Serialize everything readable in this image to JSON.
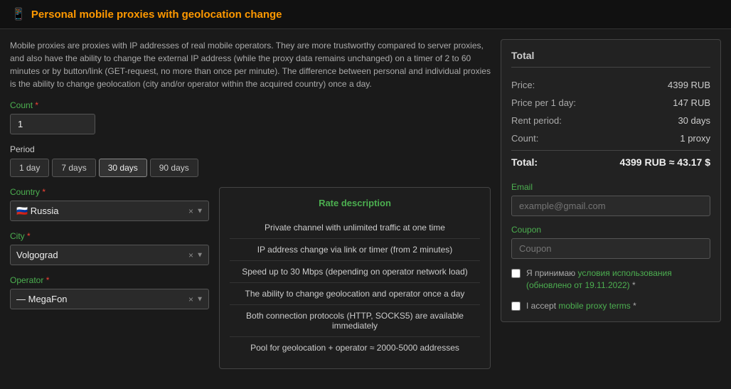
{
  "header": {
    "icon": "📱",
    "title": "Personal mobile proxies with geolocation change"
  },
  "description": "Mobile proxies are proxies with IP addresses of real mobile operators. They are more trustworthy compared to server proxies, and also have the ability to change the external IP address (while the proxy data remains unchanged) on a timer of 2 to 60 minutes or by button/link (GET-request, no more than once per minute). The difference between personal and individual proxies is the ability to change geolocation (city and/or operator within the acquired country) once a day.",
  "count": {
    "label": "Count",
    "required": "*",
    "value": "1"
  },
  "period": {
    "label": "Period",
    "options": [
      "1 day",
      "7 days",
      "30 days",
      "90 days"
    ],
    "active_index": 2
  },
  "country": {
    "label": "Country",
    "required": "*",
    "value": "Russia",
    "flag": "🇷🇺"
  },
  "city": {
    "label": "City",
    "required": "*",
    "value": "Volgograd"
  },
  "operator": {
    "label": "Operator",
    "required": "*",
    "value": "MegaFon"
  },
  "rate": {
    "title": "Rate description",
    "items": [
      "Private channel with unlimited traffic at one time",
      "IP address change via link or timer (from 2 minutes)",
      "Speed up to 30 Mbps (depending on operator network load)",
      "The ability to change geolocation and operator once a day",
      "Both connection protocols (HTTP, SOCKS5) are available immediately",
      "Pool for geolocation + operator ≈ 2000-5000 addresses"
    ]
  },
  "summary": {
    "title": "Total",
    "price_label": "Price:",
    "price_value": "4399 RUB",
    "price_per_day_label": "Price per 1 day:",
    "price_per_day_value": "147 RUB",
    "rent_period_label": "Rent period:",
    "rent_period_value": "30 days",
    "count_proxy_label": "Count:",
    "count_proxy_value": "1 proxy",
    "total_label": "Total:",
    "total_value": "4399 RUB ≈ 43.17 $"
  },
  "email": {
    "label": "Email",
    "placeholder": "example@gmail.com"
  },
  "coupon": {
    "label": "Coupon",
    "placeholder": "Coupon"
  },
  "checkboxes": {
    "terms_text": "Я принимаю ",
    "terms_link": "условия использования (обновлено от 19.11.2022)",
    "terms_suffix": " *",
    "mobile_text": "I accept ",
    "mobile_link": "mobile proxy terms",
    "mobile_suffix": " *"
  }
}
